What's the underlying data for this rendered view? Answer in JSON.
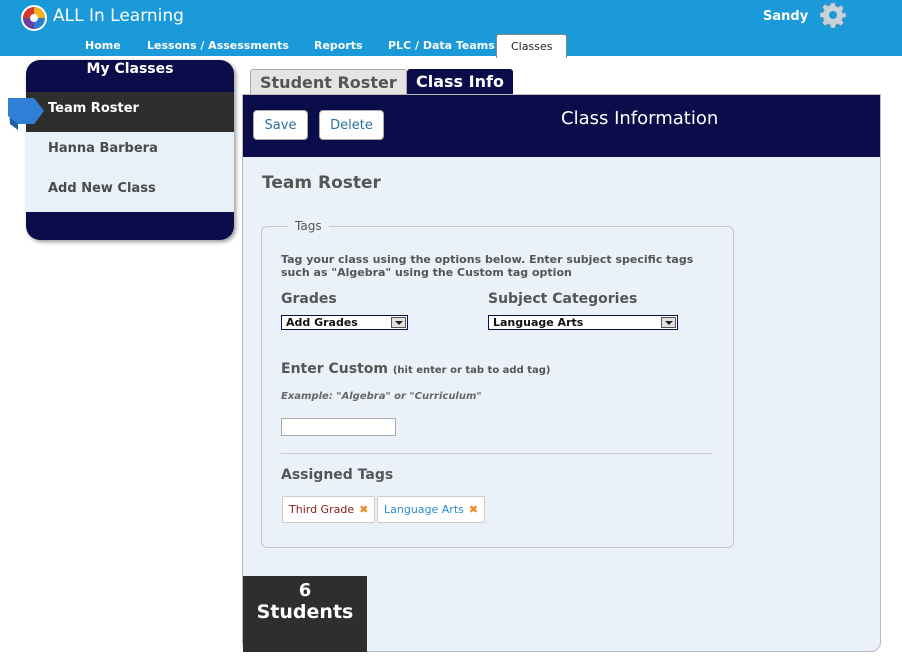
{
  "app": {
    "title": "ALL In Learning",
    "user": "Sandy"
  },
  "nav": {
    "items": [
      {
        "label": "Home"
      },
      {
        "label": "Lessons / Assessments"
      },
      {
        "label": "Reports"
      },
      {
        "label": "PLC / Data Teams"
      },
      {
        "label": "Classes"
      }
    ],
    "active": "Classes"
  },
  "sidebar": {
    "title": "My Classes",
    "items": [
      {
        "label": "Team Roster"
      },
      {
        "label": "Hanna Barbera"
      },
      {
        "label": "Add New Class"
      }
    ],
    "active": "Team Roster"
  },
  "tabs": [
    {
      "label": "Student Roster"
    },
    {
      "label": "Class Info"
    }
  ],
  "active_tab": "Class Info",
  "toolbar": {
    "save_label": "Save",
    "delete_label": "Delete"
  },
  "panel": {
    "heading": "Class Information",
    "class_name": "Team Roster"
  },
  "tags": {
    "legend": "Tags",
    "description": "Tag your class using the options below. Enter subject specific tags such as \"Algebra\" using the Custom tag option",
    "grades_label": "Grades",
    "grades_value": "Add Grades",
    "subject_label": "Subject Categories",
    "subject_value": "Language Arts",
    "custom_label": "Enter Custom",
    "custom_hint": "(hit enter or tab to add tag)",
    "custom_example": "Example: \"Algebra\" or \"Curriculum\"",
    "custom_value": "",
    "assigned_label": "Assigned Tags",
    "assigned": [
      {
        "label": "Third Grade",
        "color": "#8b1a1a"
      },
      {
        "label": "Language Arts",
        "color": "#2a8fd0"
      }
    ],
    "remove_glyph": "✖"
  },
  "students": {
    "count": "6",
    "label": "Students"
  },
  "colors": {
    "header_blue": "#1a9ad8",
    "navy": "#0b0c4a",
    "panel_bg": "#eaf1f8",
    "dark_gray": "#2e2e2e",
    "remove_orange": "#f08a1c"
  },
  "icons": {
    "logo": "all-in-learning-logo",
    "settings": "gear-icon",
    "pointer": "arrow-pointer-icon"
  }
}
